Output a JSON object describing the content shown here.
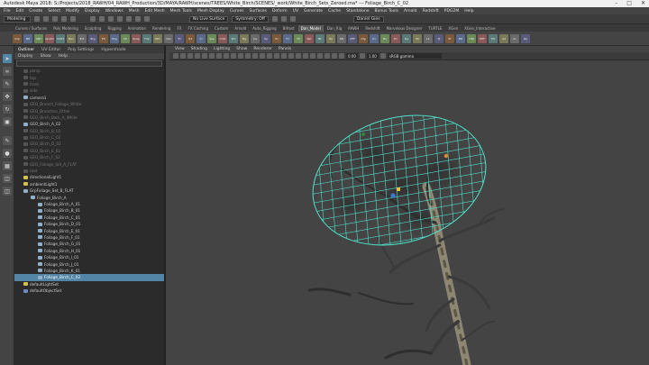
{
  "window": {
    "title": "Autodesk Maya 2018: S:/Projects/2018_RAWH/04_RAWH_Production/3D/MAYA/RAWH/scenes/TREES/White_Birch/SCENES/_work/White_Birch_Sets_Zeroed.ma*   ---   Foliage_Birch_C_02"
  },
  "menubar": [
    "File",
    "Edit",
    "Create",
    "Select",
    "Modify",
    "Display",
    "Windows",
    "Mesh",
    "Edit Mesh",
    "Mesh Tools",
    "Mesh Display",
    "Curves",
    "Surfaces",
    "Deform",
    "UV",
    "Generate",
    "Cache",
    "Standalone",
    "Bonus Tools",
    "Arnold",
    "Redshift",
    "PDG2M",
    "Help"
  ],
  "statusline": {
    "mode": "Modeling",
    "live_surface": "No Live Surface",
    "symmetry": "Symmetry: Off",
    "user": "Daniel Gies"
  },
  "shelf_tabs": [
    {
      "label": "Curves / Surfaces",
      "active": false
    },
    {
      "label": "Poly Modeling",
      "active": false
    },
    {
      "label": "Sculpting",
      "active": false
    },
    {
      "label": "Rigging",
      "active": false
    },
    {
      "label": "Animation",
      "active": false
    },
    {
      "label": "Rendering",
      "active": false
    },
    {
      "label": "FX",
      "active": false
    },
    {
      "label": "FX Caching",
      "active": false
    },
    {
      "label": "Custom",
      "active": false
    },
    {
      "label": "Arnold",
      "active": false
    },
    {
      "label": "Auto_Rigging",
      "active": false
    },
    {
      "label": "Bifrost",
      "active": false
    },
    {
      "label": "Dan_Model",
      "active": true
    },
    {
      "label": "Dan_Rig",
      "active": false
    },
    {
      "label": "RAWH",
      "active": false
    },
    {
      "label": "Redshift",
      "active": false
    },
    {
      "label": "Marvelous Designer",
      "active": false
    },
    {
      "label": "TURTLE",
      "active": false
    },
    {
      "label": "XGen",
      "active": false
    },
    {
      "label": "XGen_Interactive",
      "active": false
    }
  ],
  "shelf_buttons": [
    "Imp",
    "NH",
    "ANY",
    "Dan/Dic",
    "CAD3",
    "Bev",
    "Ext",
    "Brg",
    "Fill",
    "Mrg",
    "Ctr",
    "Snap",
    "Flip",
    "Mirr",
    "Del",
    "Tri",
    "Qd",
    "Cl",
    "Sep",
    "Cmb",
    "Sm",
    "Mg",
    "Inv",
    "Cp",
    "Pv",
    "Fz",
    "Ht",
    "Rst",
    "Bk",
    "Ns",
    "ON",
    "OFF",
    "Cfg",
    "Uv",
    "Bo",
    "Ex",
    "Dp",
    "Sh",
    "Lk",
    "Pj",
    "Pt",
    "BO",
    "OBJ",
    "DEF",
    "Tbl",
    "Ad",
    "Gr",
    "Re"
  ],
  "outliner": {
    "tabs": [
      "Outliner",
      "UV Editor",
      "Poly Settings",
      "Hypershade"
    ],
    "menu": [
      "Display",
      "Show",
      "Help"
    ],
    "items": [
      {
        "label": "persp",
        "dim": true
      },
      {
        "label": "top",
        "dim": true
      },
      {
        "label": "front",
        "dim": true
      },
      {
        "label": "side",
        "dim": true
      },
      {
        "label": "camera1",
        "dim": false
      },
      {
        "label": "GEO_Branch_Foliage_White",
        "dim": true
      },
      {
        "label": "GEO_Branches_Other",
        "dim": true
      },
      {
        "label": "GEO_Birch_Bark_A_White",
        "dim": true
      },
      {
        "label": "GEO_Birch_A_02",
        "dim": false
      },
      {
        "label": "GEO_Birch_B_02",
        "dim": true
      },
      {
        "label": "GEO_Birch_C_02",
        "dim": true
      },
      {
        "label": "GEO_Birch_D_02",
        "dim": true
      },
      {
        "label": "GEO_Birch_E_02",
        "dim": true
      },
      {
        "label": "GEO_Birch_F_02",
        "dim": true
      },
      {
        "label": "GEO_Foliage_Set_A_FLAT",
        "dim": true
      },
      {
        "label": "root",
        "dim": true
      },
      {
        "label": "directionalLight1",
        "dim": false
      },
      {
        "label": "ambientLight1",
        "dim": false
      },
      {
        "label": "GrpFoliage_Set_B_FLAT",
        "dim": false
      },
      {
        "label": "Foliage_Birch_A",
        "dim": false
      },
      {
        "label": "Foliage_Birch_A_01",
        "dim": false
      },
      {
        "label": "Foliage_Birch_B_01",
        "dim": false
      },
      {
        "label": "Foliage_Birch_C_01",
        "dim": false
      },
      {
        "label": "Foliage_Birch_D_01",
        "dim": false
      },
      {
        "label": "Foliage_Birch_E_01",
        "dim": false
      },
      {
        "label": "Foliage_Birch_F_01",
        "dim": false
      },
      {
        "label": "Foliage_Birch_G_01",
        "dim": false
      },
      {
        "label": "Foliage_Birch_H_01",
        "dim": false
      },
      {
        "label": "Foliage_Birch_I_01",
        "dim": false
      },
      {
        "label": "Foliage_Birch_J_01",
        "dim": false
      },
      {
        "label": "Foliage_Birch_K_01",
        "dim": false
      },
      {
        "label": "Foliage_Birch_C_02",
        "dim": false,
        "selected": true
      },
      {
        "label": "defaultLightSet",
        "dim": false
      },
      {
        "label": "defaultObjectSet",
        "dim": false
      }
    ]
  },
  "viewport": {
    "menu": [
      "View",
      "Shading",
      "Lighting",
      "Show",
      "Renderer",
      "Panels"
    ],
    "near": "0.00",
    "far": "1.00",
    "colorspace": "sRGB gamma"
  }
}
